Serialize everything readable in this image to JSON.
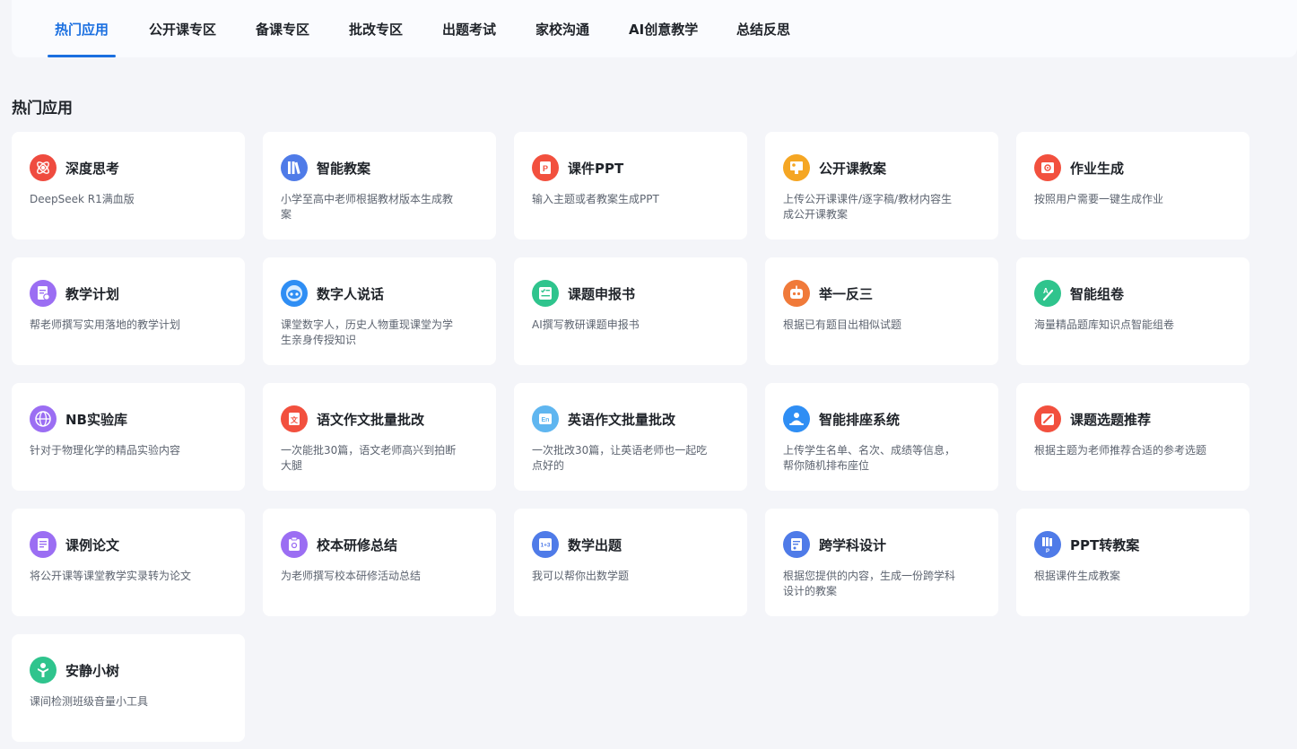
{
  "nav": {
    "tabs": [
      "热门应用",
      "公开课专区",
      "备课专区",
      "批改专区",
      "出题考试",
      "家校沟通",
      "AI创意教学",
      "总结反思"
    ],
    "active": "热门应用"
  },
  "section": {
    "title": "热门应用"
  },
  "apps": [
    {
      "title": "深度思考",
      "desc": "DeepSeek R1满血版",
      "icon": "atom-icon",
      "color": "#ef4b3f"
    },
    {
      "title": "智能教案",
      "desc": "小学至高中老师根据教材版本生成教案",
      "icon": "books-icon",
      "color": "#4f7be8"
    },
    {
      "title": "课件PPT",
      "desc": "输入主题或者教案生成PPT",
      "icon": "ppt-icon",
      "color": "#f2503e"
    },
    {
      "title": "公开课教案",
      "desc": "上传公开课课件/逐字稿/教材内容生成公开课教案",
      "icon": "lecture-icon",
      "color": "#f5a623"
    },
    {
      "title": "作业生成",
      "desc": "按照用户需要一键生成作业",
      "icon": "homework-icon",
      "color": "#f2503e"
    },
    {
      "title": "教学计划",
      "desc": "帮老师撰写实用落地的教学计划",
      "icon": "plan-icon",
      "color": "#9b6ef3"
    },
    {
      "title": "数字人说话",
      "desc": "课堂数字人，历史人物重现课堂为学生亲身传授知识",
      "icon": "robot-face-icon",
      "color": "#2f8ef4"
    },
    {
      "title": "课题申报书",
      "desc": "AI撰写教研课题申报书",
      "icon": "form-check-icon",
      "color": "#2fc48d"
    },
    {
      "title": "举一反三",
      "desc": "根据已有题目出相似试题",
      "icon": "robot-icon",
      "color": "#f07a3a"
    },
    {
      "title": "智能组卷",
      "desc": "海量精品题库知识点智能组卷",
      "icon": "paper-pen-icon",
      "color": "#2fc48d"
    },
    {
      "title": "NB实验库",
      "desc": "针对于物理化学的精品实验内容",
      "icon": "globe-icon",
      "color": "#9b6ef3"
    },
    {
      "title": "语文作文批量批改",
      "desc": "一次能批30篇，语文老师高兴到拍断大腿",
      "icon": "chinese-essay-icon",
      "color": "#f2503e"
    },
    {
      "title": "英语作文批量批改",
      "desc": "一次批改30篇，让英语老师也一起吃点好的",
      "icon": "english-essay-icon",
      "color": "#5fb6f0"
    },
    {
      "title": "智能排座系统",
      "desc": "上传学生名单、名次、成绩等信息，帮你随机排布座位",
      "icon": "seat-icon",
      "color": "#2f8ef4"
    },
    {
      "title": "课题选题推荐",
      "desc": "根据主题为老师推荐合适的参考选题",
      "icon": "edit-icon",
      "color": "#f2503e"
    },
    {
      "title": "课例论文",
      "desc": "将公开课等课堂教学实录转为论文",
      "icon": "doc-icon",
      "color": "#9b6ef3"
    },
    {
      "title": "校本研修总结",
      "desc": "为老师撰写校本研修活动总结",
      "icon": "clipboard-icon",
      "color": "#9b6ef3"
    },
    {
      "title": "数学出题",
      "desc": "我可以帮你出数学题",
      "icon": "math-icon",
      "color": "#4f7be8"
    },
    {
      "title": "跨学科设计",
      "desc": "根据您提供的内容，生成一份跨学科设计的教案",
      "icon": "design-icon",
      "color": "#4f7be8"
    },
    {
      "title": "PPT转教案",
      "desc": "根据课件生成教案",
      "icon": "ppt-convert-icon",
      "color": "#4f7be8"
    },
    {
      "title": "安静小树",
      "desc": "课间检测班级音量小工具",
      "icon": "tree-icon",
      "color": "#2fc48d"
    }
  ]
}
